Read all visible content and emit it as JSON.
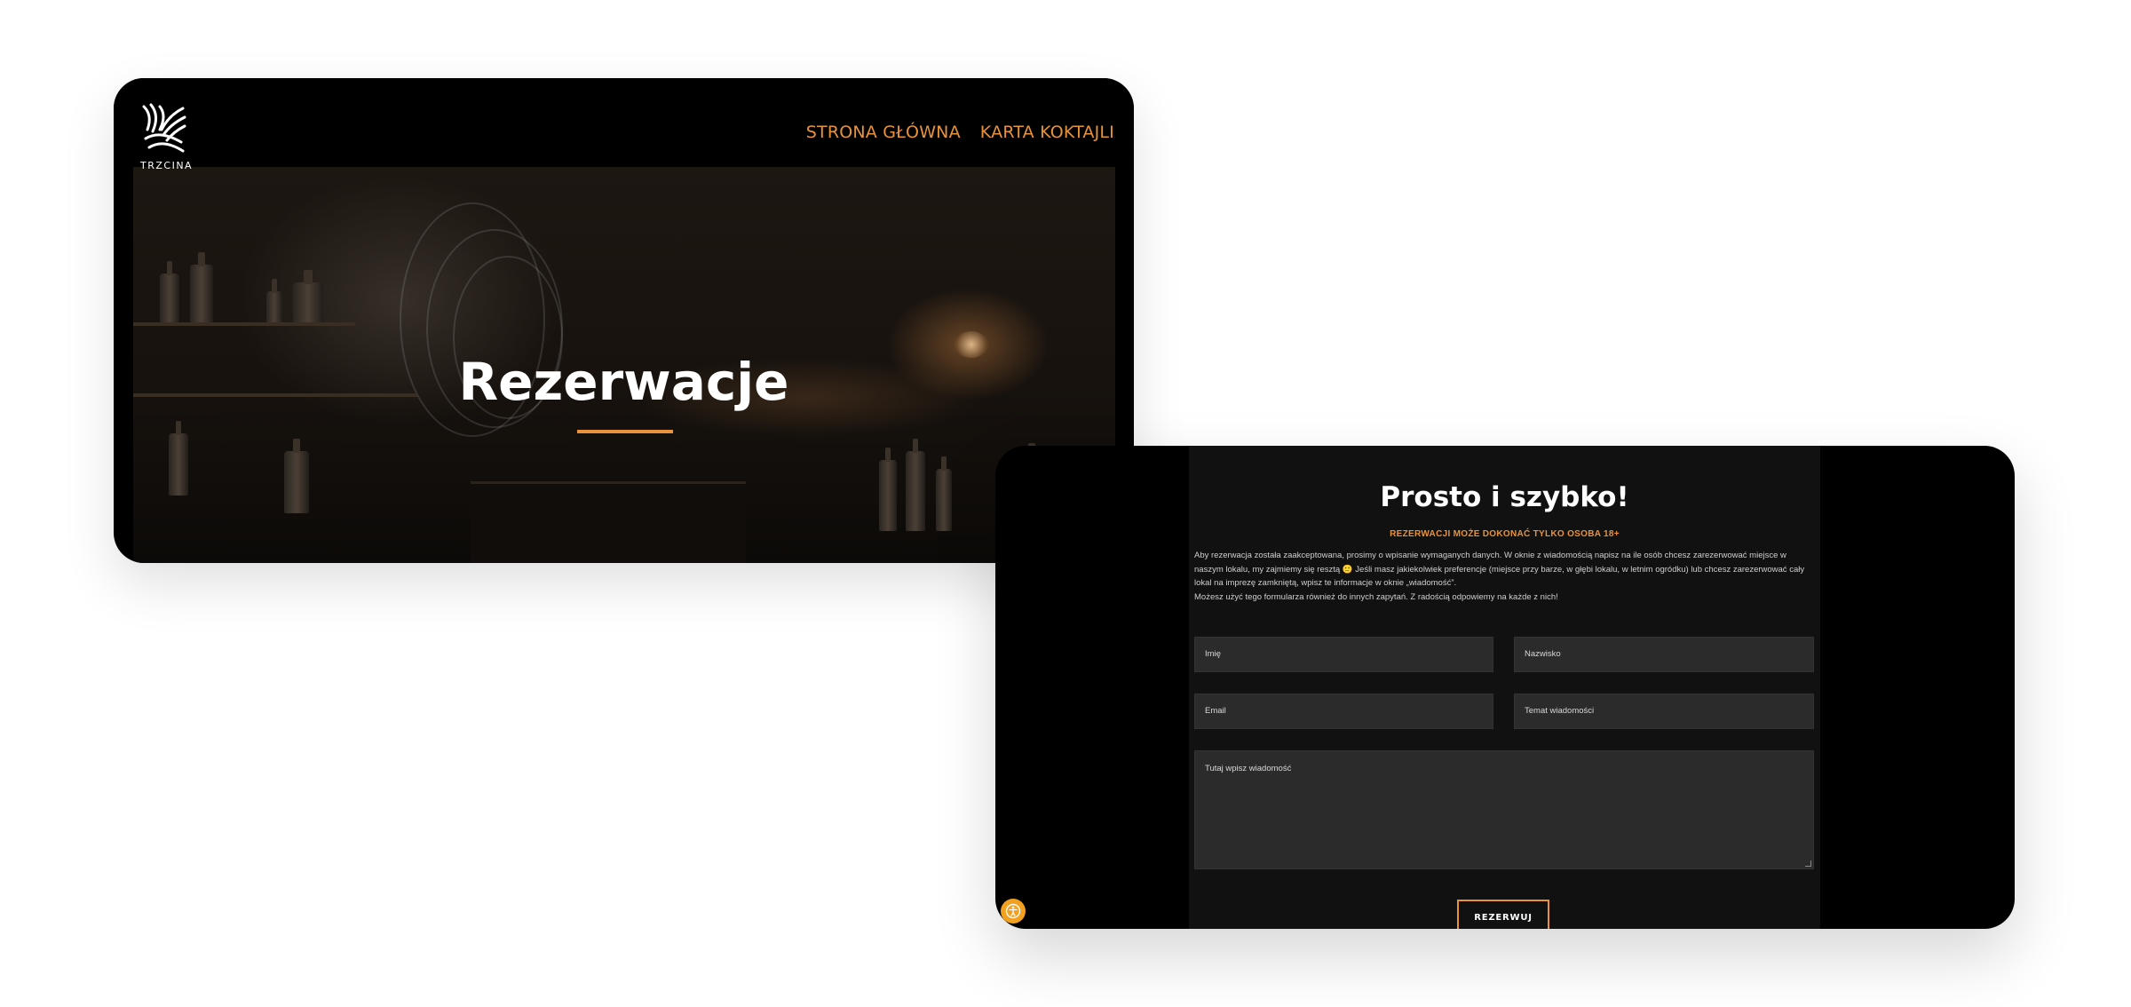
{
  "hero_card": {
    "logo": {
      "icon": "trzcina-reed-logo-icon",
      "text": "TRZCINA"
    },
    "nav": {
      "home": "STRONA GŁÓWNA",
      "menu": "KARTA KOKTAJLI"
    },
    "title": "Rezerwacje"
  },
  "form_card": {
    "title": "Prosto i szybko!",
    "subtitle": "REZERWACJI MOŻE DOKONAĆ TYLKO OSOBA 18+",
    "description": [
      "Aby rezerwacja została zaakceptowana, prosimy o wpisanie wymaganych danych. W oknie z wiadomością napisz na ile osób chcesz zarezerwować miejsce w naszym lokalu, my zajmiemy się resztą 🙂 Jeśli masz jakiekolwiek preferencje (miejsce przy barze, w głębi lokalu, w letnim ogródku) lub chcesz zarezerwować cały lokal na imprezę zamkniętą, wpisz te informacje w oknie „wiadomość”.",
      "Możesz użyć tego formularza również do innych zapytań. Z radością odpowiemy na każde z nich!"
    ],
    "fields": {
      "first_name": "Imię",
      "last_name": "Nazwisko",
      "email": "Email",
      "subject": "Temat wiadomości",
      "message": "Tutaj wpisz wiadomość"
    },
    "submit": "REZERWUJ",
    "accessibility_icon": "accessibility-icon"
  },
  "colors": {
    "accent": "#e8923a",
    "panel": "#111111",
    "field": "#2b2b2b",
    "badge": "#f1a11f"
  }
}
